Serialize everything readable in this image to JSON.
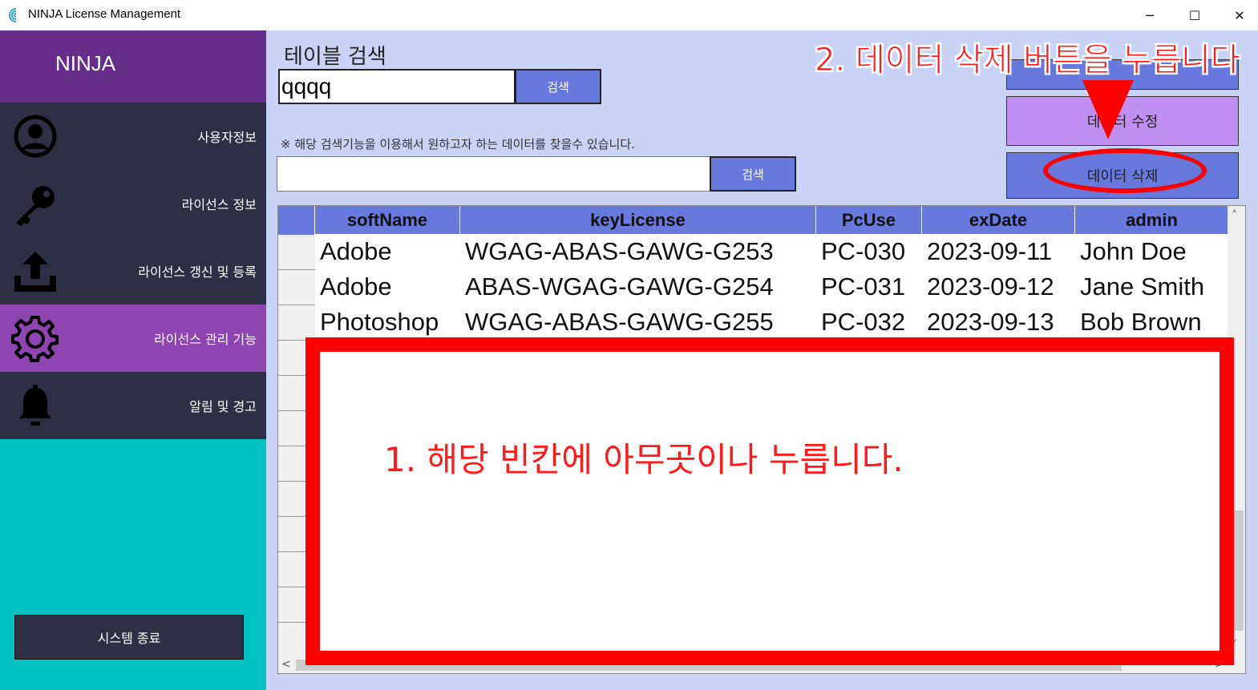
{
  "window": {
    "title": "NINJA License Management",
    "minimize": "─",
    "maximize": "☐",
    "close": "✕"
  },
  "sidebar": {
    "brand": "NINJA",
    "items": [
      {
        "label": "사용자정보",
        "icon": "user-icon"
      },
      {
        "label": "라이선스 정보",
        "icon": "key-icon"
      },
      {
        "label": "라이선스 갱신 및 등록",
        "icon": "upload-icon"
      },
      {
        "label": "라이선스 관리 기능",
        "icon": "gear-icon",
        "active": true
      },
      {
        "label": "알림 및 경고",
        "icon": "bell-icon"
      }
    ],
    "exit_label": "시스템 종료"
  },
  "search": {
    "title": "테이블 검색",
    "value": "qqqq",
    "button": "검색",
    "hint": "※ 해당 검색기능을 이용해서 원하고자 하는 데이터를 찾을수 있습니다.",
    "value2": "",
    "button2": "검색"
  },
  "actions": {
    "edit_label": "데이터 수정",
    "delete_label": "데이터 삭제"
  },
  "table": {
    "columns": [
      "softName",
      "keyLicense",
      "PcUse",
      "exDate",
      "admin"
    ],
    "rows": [
      [
        "Adobe",
        "WGAG-ABAS-GAWG-G253",
        "PC-030",
        "2023-09-11",
        "John Doe"
      ],
      [
        "Adobe",
        "ABAS-WGAG-GAWG-G254",
        "PC-031",
        "2023-09-12",
        "Jane Smith"
      ],
      [
        "Photoshop",
        "WGAG-ABAS-GAWG-G255",
        "PC-032",
        "2023-09-13",
        "Bob Brown"
      ]
    ]
  },
  "annotations": {
    "step1": "1. 해당 빈칸에 아무곳이나 누릅니다.",
    "step2": "2. 데이터 삭제 버튼을 누릅니다",
    "color": "#ff0000"
  },
  "colors": {
    "sidebar_bg": "#2e2f45",
    "sidebar_active": "#8e44b1",
    "brand_bg": "#662d8a",
    "sidebar_fill": "#00c2c0",
    "main_bg": "#c8d3f5",
    "button_blue": "#6879de",
    "button_purple": "#c18ff2"
  }
}
